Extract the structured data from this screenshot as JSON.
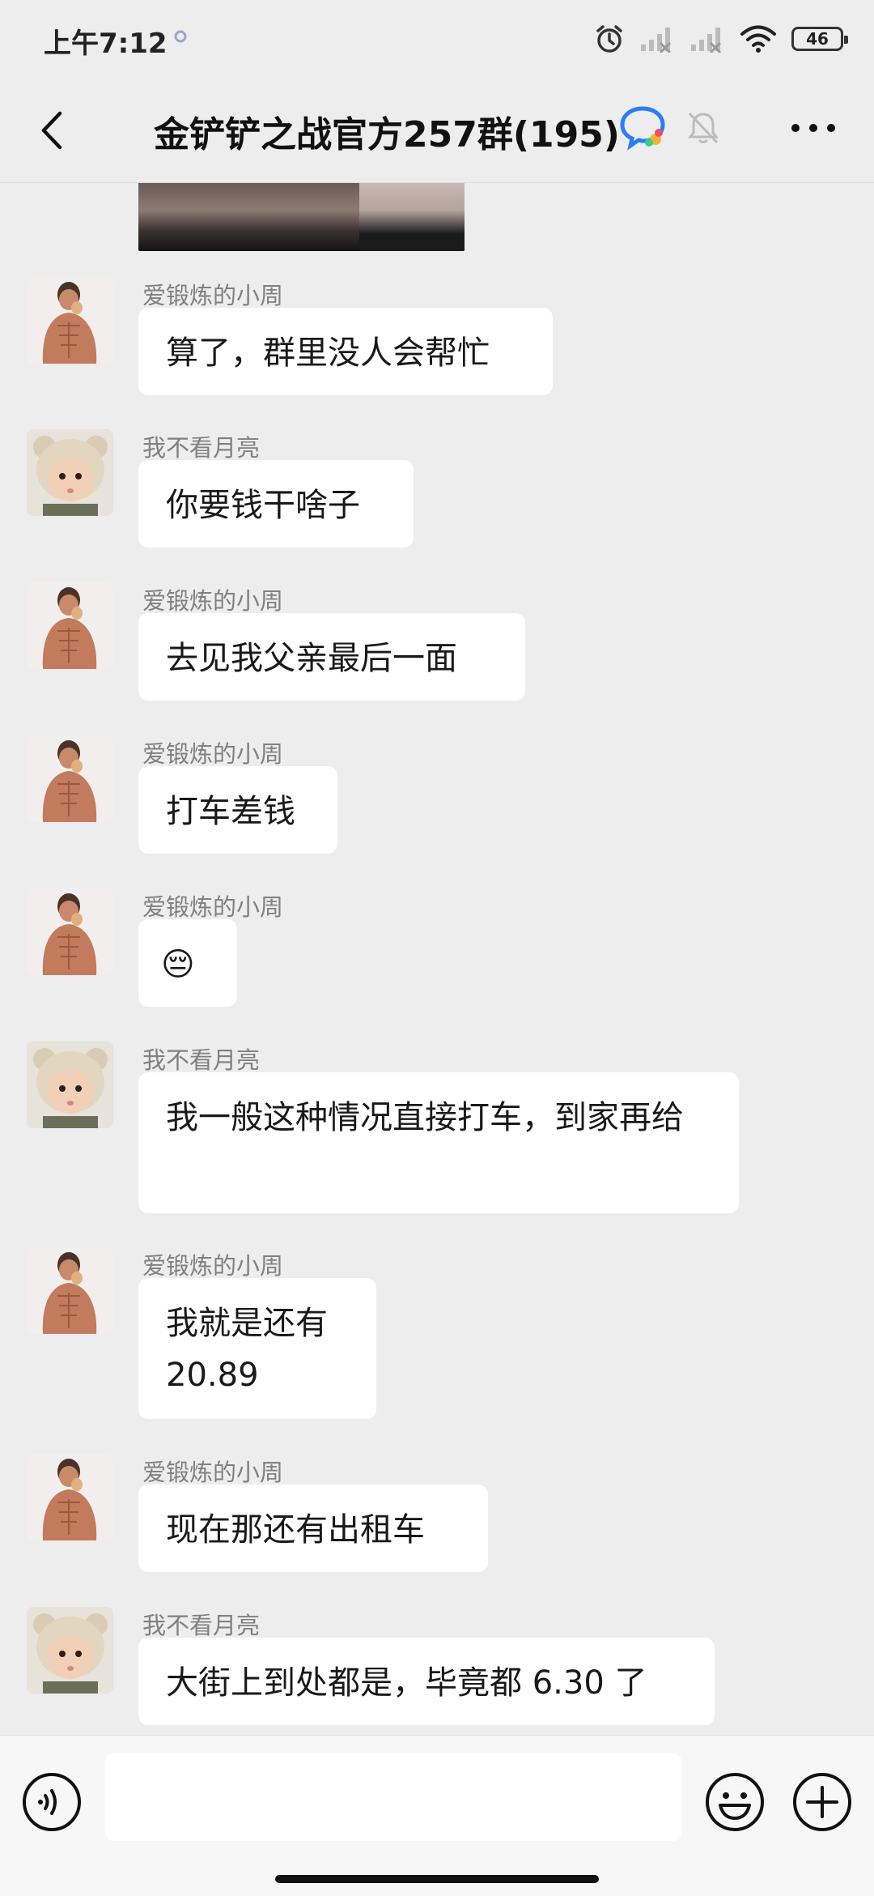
{
  "status_bar": {
    "time": "上午7:12",
    "battery": "46"
  },
  "header": {
    "title": "金铲铲之战官方257群(195)"
  },
  "messages": [
    {
      "sender": "爱锻炼的小周",
      "text": "算了，群里没人会帮忙",
      "avatar": "muscle-man"
    },
    {
      "sender": "我不看月亮",
      "text": "你要钱干啥子",
      "avatar": "baby-bear-hat"
    },
    {
      "sender": "爱锻炼的小周",
      "text": "去见我父亲最后一面",
      "avatar": "muscle-man"
    },
    {
      "sender": "爱锻炼的小周",
      "text": "打车差钱",
      "avatar": "muscle-man"
    },
    {
      "sender": "爱锻炼的小周",
      "text": "😔",
      "avatar": "muscle-man"
    },
    {
      "sender": "我不看月亮",
      "text": "我一般这种情况直接打车，到家再给",
      "avatar": "baby-bear-hat"
    },
    {
      "sender": "爱锻炼的小周",
      "text": "我就是还有20.89",
      "avatar": "muscle-man"
    },
    {
      "sender": "爱锻炼的小周",
      "text": "现在那还有出租车",
      "avatar": "muscle-man"
    },
    {
      "sender": "我不看月亮",
      "text": "大街上到处都是，毕竟都 6.30 了",
      "avatar": "baby-bear-hat"
    }
  ],
  "input": {
    "placeholder": ""
  },
  "icons": {
    "back": "chevron-left-icon",
    "qq": "qq-logo-icon",
    "mute": "bell-muted-icon",
    "more": "ellipsis-icon",
    "voice": "voice-icon",
    "emoji": "smile-icon",
    "plus": "plus-icon"
  },
  "colors": {
    "background": "#ededed",
    "bubble": "#ffffff",
    "sender_name": "#808080"
  }
}
